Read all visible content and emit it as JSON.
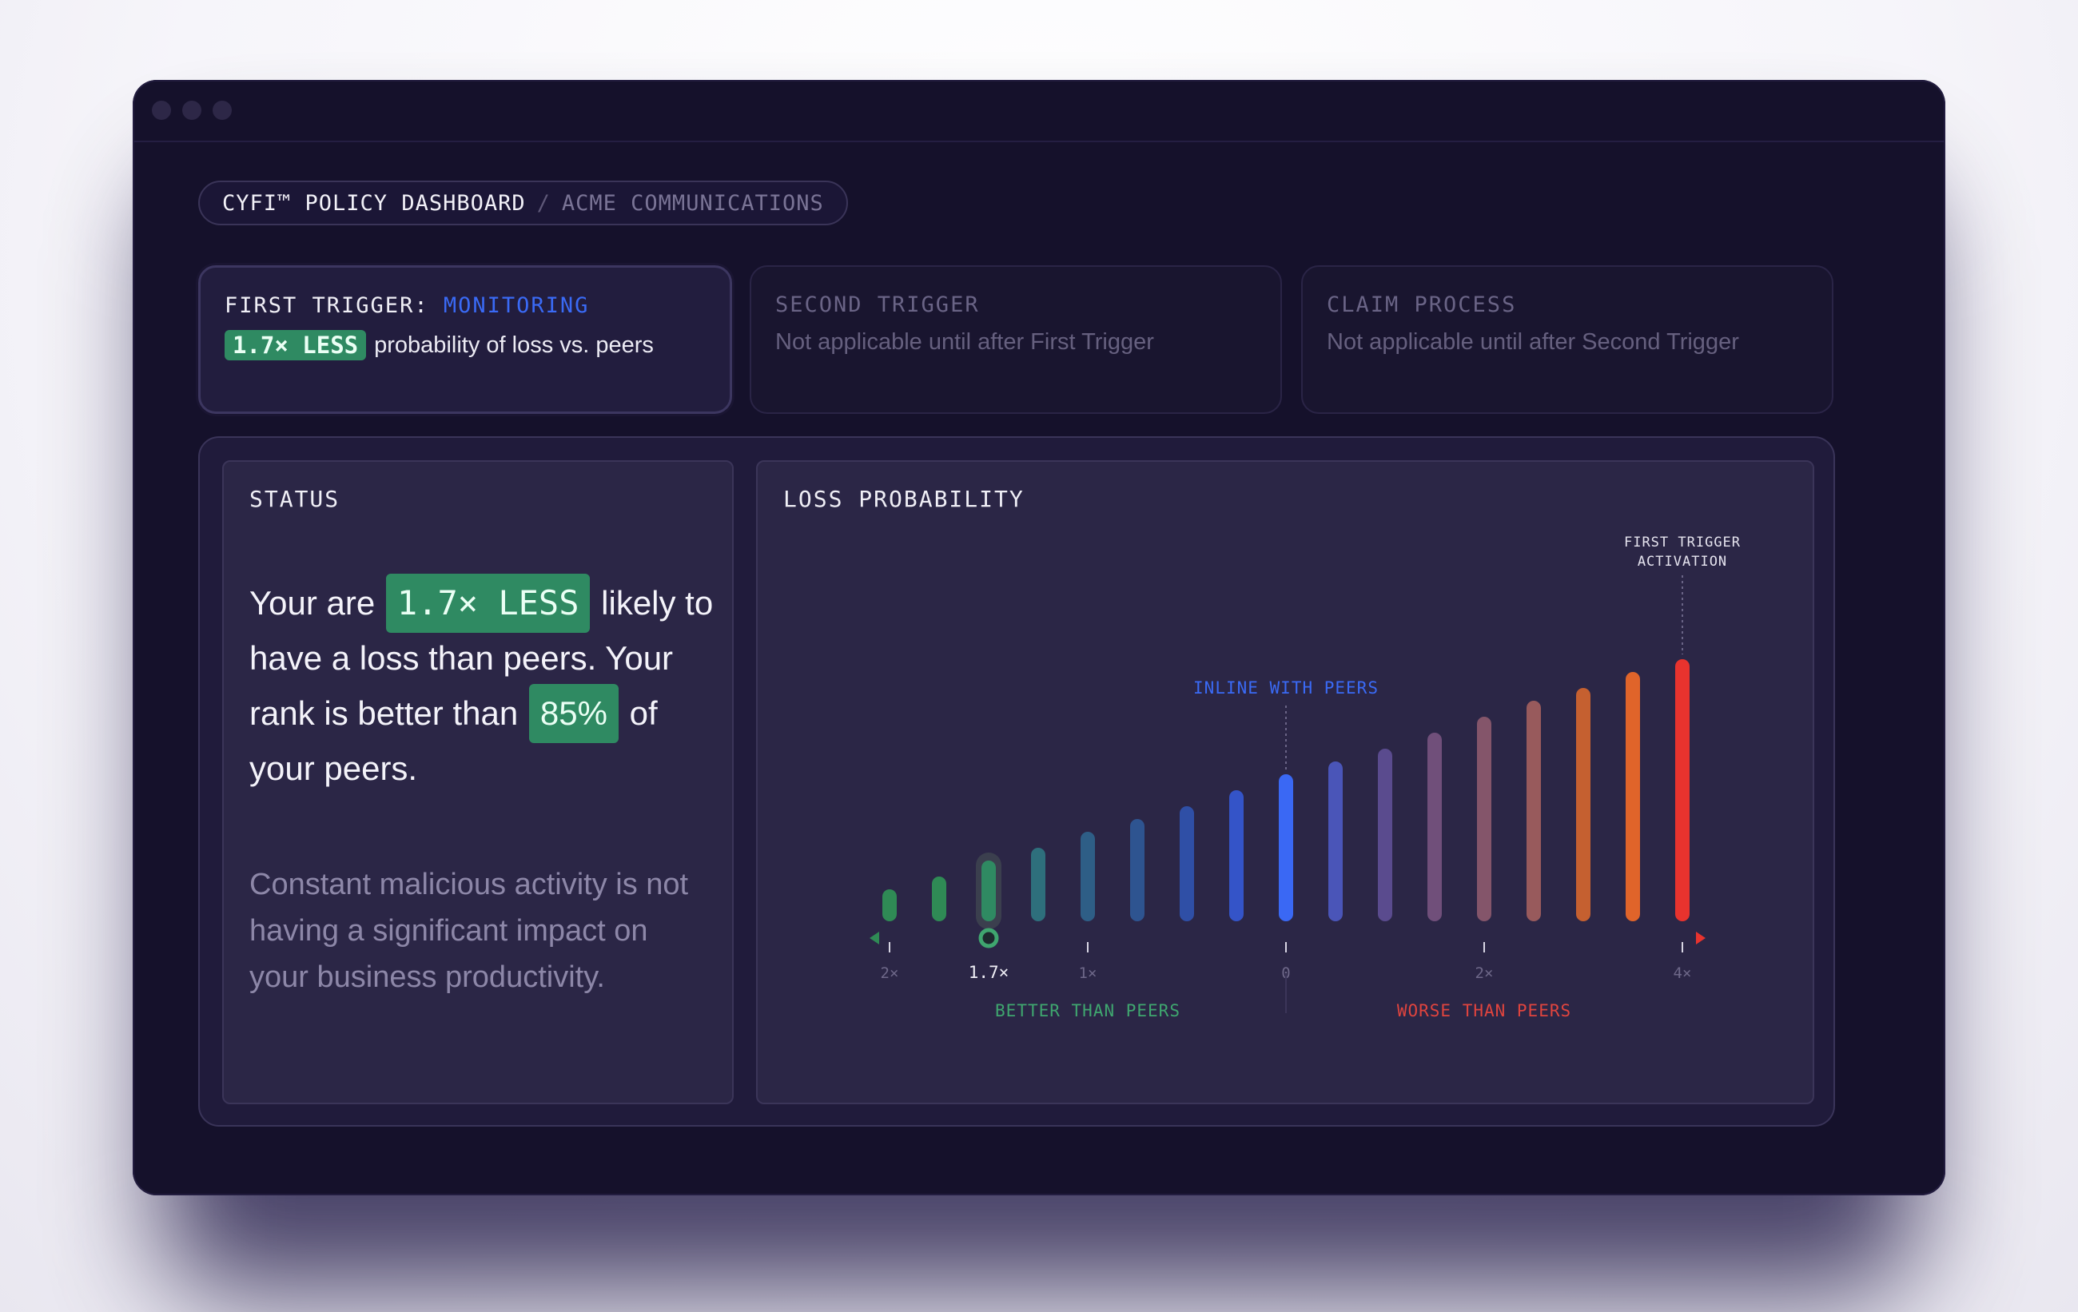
{
  "breadcrumb": {
    "title": "CYFI™ POLICY DASHBOARD",
    "separator": "/",
    "company": "ACME COMMUNICATIONS"
  },
  "triggers": [
    {
      "label": "FIRST TRIGGER:",
      "state": "MONITORING",
      "badge": "1.7× LESS",
      "text": "probability of loss vs. peers"
    },
    {
      "label": "SECOND TRIGGER",
      "text": "Not applicable until after First Trigger"
    },
    {
      "label": "CLAIM PROCESS",
      "text": "Not applicable until after Second Trigger"
    }
  ],
  "status": {
    "title": "STATUS",
    "p1": "Your are",
    "h1": "1.7× LESS",
    "p2": "likely to have a loss than peers. Your rank is better than",
    "h2": "85%",
    "p3": "of your peers.",
    "note": "Constant malicious activity is not having a significant impact on your business productivity."
  },
  "loss": {
    "title": "LOSS PROBABILITY",
    "annotations": {
      "inline": "INLINE WITH PEERS",
      "trigger_line1": "FIRST TRIGGER",
      "trigger_line2": "ACTIVATION"
    },
    "labels": {
      "better": "BETTER THAN PEERS",
      "worse": "WORSE THAN PEERS"
    }
  },
  "colors": {
    "accent_green": "#2f8a62",
    "accent_blue": "#3a6af5",
    "accent_red": "#e8332e"
  },
  "chart_data": {
    "type": "bar",
    "title": "LOSS PROBABILITY",
    "x_ticks": [
      "2×",
      "1.7×",
      "1×",
      "0",
      "2×",
      "4×"
    ],
    "categories": [
      "2×",
      "",
      "1.7×",
      "",
      "1×",
      "",
      "",
      "",
      "0",
      "",
      "",
      "",
      "2×",
      "",
      "",
      "",
      "4×"
    ],
    "values": [
      1,
      1.4,
      1.9,
      2.3,
      2.8,
      3.2,
      3.6,
      4.1,
      4.6,
      5.0,
      5.4,
      5.9,
      6.4,
      6.9,
      7.3,
      7.8,
      8.2
    ],
    "current_index": 2,
    "current_label": "1.7×",
    "inline_index": 8,
    "trigger_index": 16,
    "colors": [
      "#2f8a55",
      "#2f8a55",
      "#2f8a62",
      "#2e6f7c",
      "#2e5e86",
      "#2e5490",
      "#2f4fa6",
      "#3454c8",
      "#3a68f4",
      "#4a55b8",
      "#5a4b8e",
      "#704f7a",
      "#84556a",
      "#985a5c",
      "#c56030",
      "#e0642a",
      "#e8332e"
    ]
  }
}
